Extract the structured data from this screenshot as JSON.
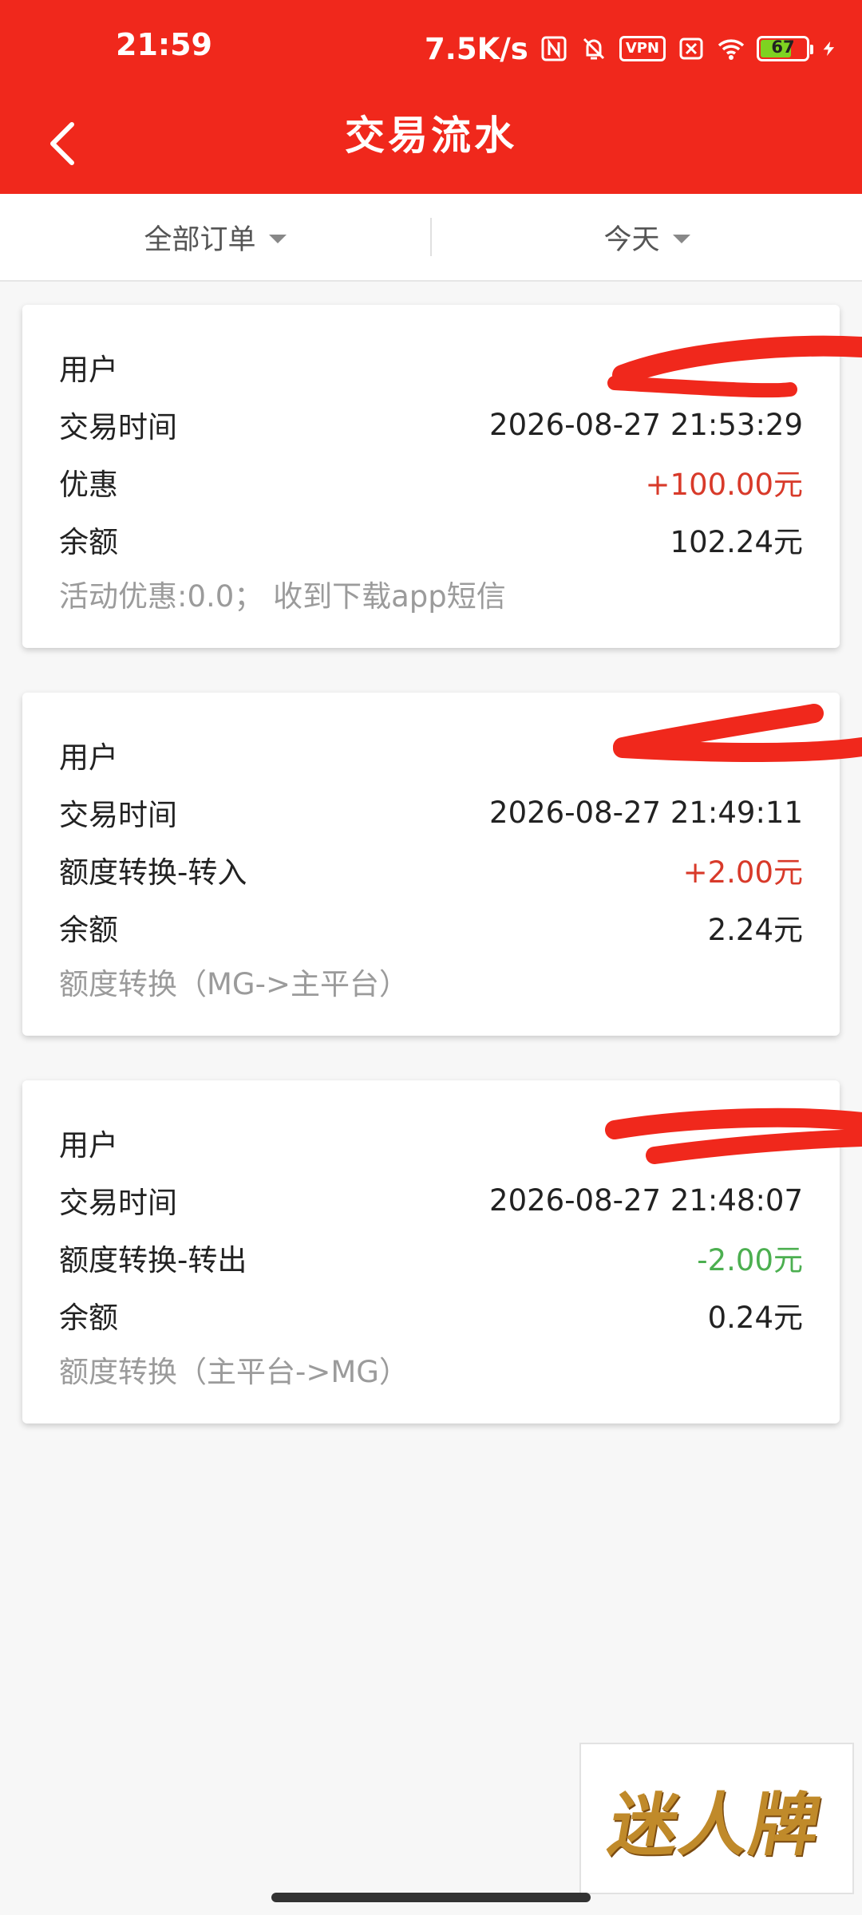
{
  "status_bar": {
    "time": "21:59",
    "net_speed": "7.5K/s",
    "vpn": "VPN",
    "battery": "67",
    "battery_level": 0.67
  },
  "header": {
    "title": "交易流水",
    "back_icon": "chevron-left-icon",
    "color": "#f0281c"
  },
  "filters": {
    "order_type": "全部订单",
    "date_range": "今天"
  },
  "transactions": [
    {
      "user_label": "用户",
      "time_label": "交易时间",
      "time": "2026-08-27 21:53:29",
      "type_label": "优惠",
      "amount": "+100.00元",
      "amount_color": "#d83a2a",
      "balance_label": "余额",
      "balance": "102.24元",
      "note": "活动优惠:0.0；  收到下载app短信"
    },
    {
      "user_label": "用户",
      "time_label": "交易时间",
      "time": "2026-08-27 21:49:11",
      "type_label": "额度转换-转入",
      "amount": "+2.00元",
      "amount_color": "#d83a2a",
      "balance_label": "余额",
      "balance": "2.24元",
      "note": "额度转换（MG->主平台）"
    },
    {
      "user_label": "用户",
      "time_label": "交易时间",
      "time": "2026-08-27 21:48:07",
      "type_label": "额度转换-转出",
      "amount": "-2.00元",
      "amount_color": "#4caf50",
      "balance_label": "余额",
      "balance": "0.24元",
      "note": "额度转换（主平台->MG）"
    }
  ],
  "watermark": {
    "text": "迷人牌"
  }
}
